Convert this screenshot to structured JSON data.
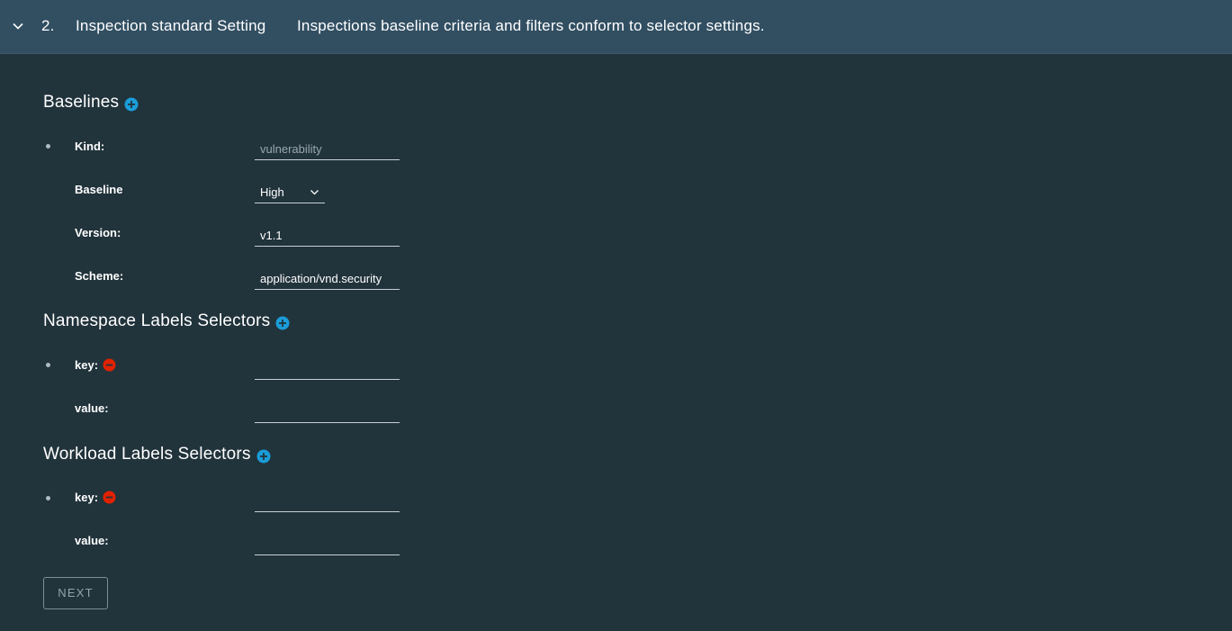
{
  "header": {
    "step_number": "2.",
    "title": "Inspection standard Setting",
    "description": "Inspections baseline criteria and filters conform to selector settings."
  },
  "baselines": {
    "title": "Baselines",
    "kind_label": "Kind:",
    "kind_value": "vulnerability",
    "baseline_label": "Baseline",
    "baseline_value": "High",
    "version_label": "Version:",
    "version_value": "v1.1",
    "scheme_label": "Scheme:",
    "scheme_value": "application/vnd.security"
  },
  "namespace_selectors": {
    "title": "Namespace Labels Selectors",
    "key_label": "key:",
    "key_value": "",
    "value_label": "value:",
    "value_value": ""
  },
  "workload_selectors": {
    "title": "Workload Labels Selectors",
    "key_label": "key:",
    "key_value": "",
    "value_label": "value:",
    "value_value": ""
  },
  "next_button": "NEXT",
  "colors": {
    "background": "#21333b",
    "header": "#324f62",
    "add_icon": "#1b9dd9",
    "remove_icon": "#e12200"
  }
}
